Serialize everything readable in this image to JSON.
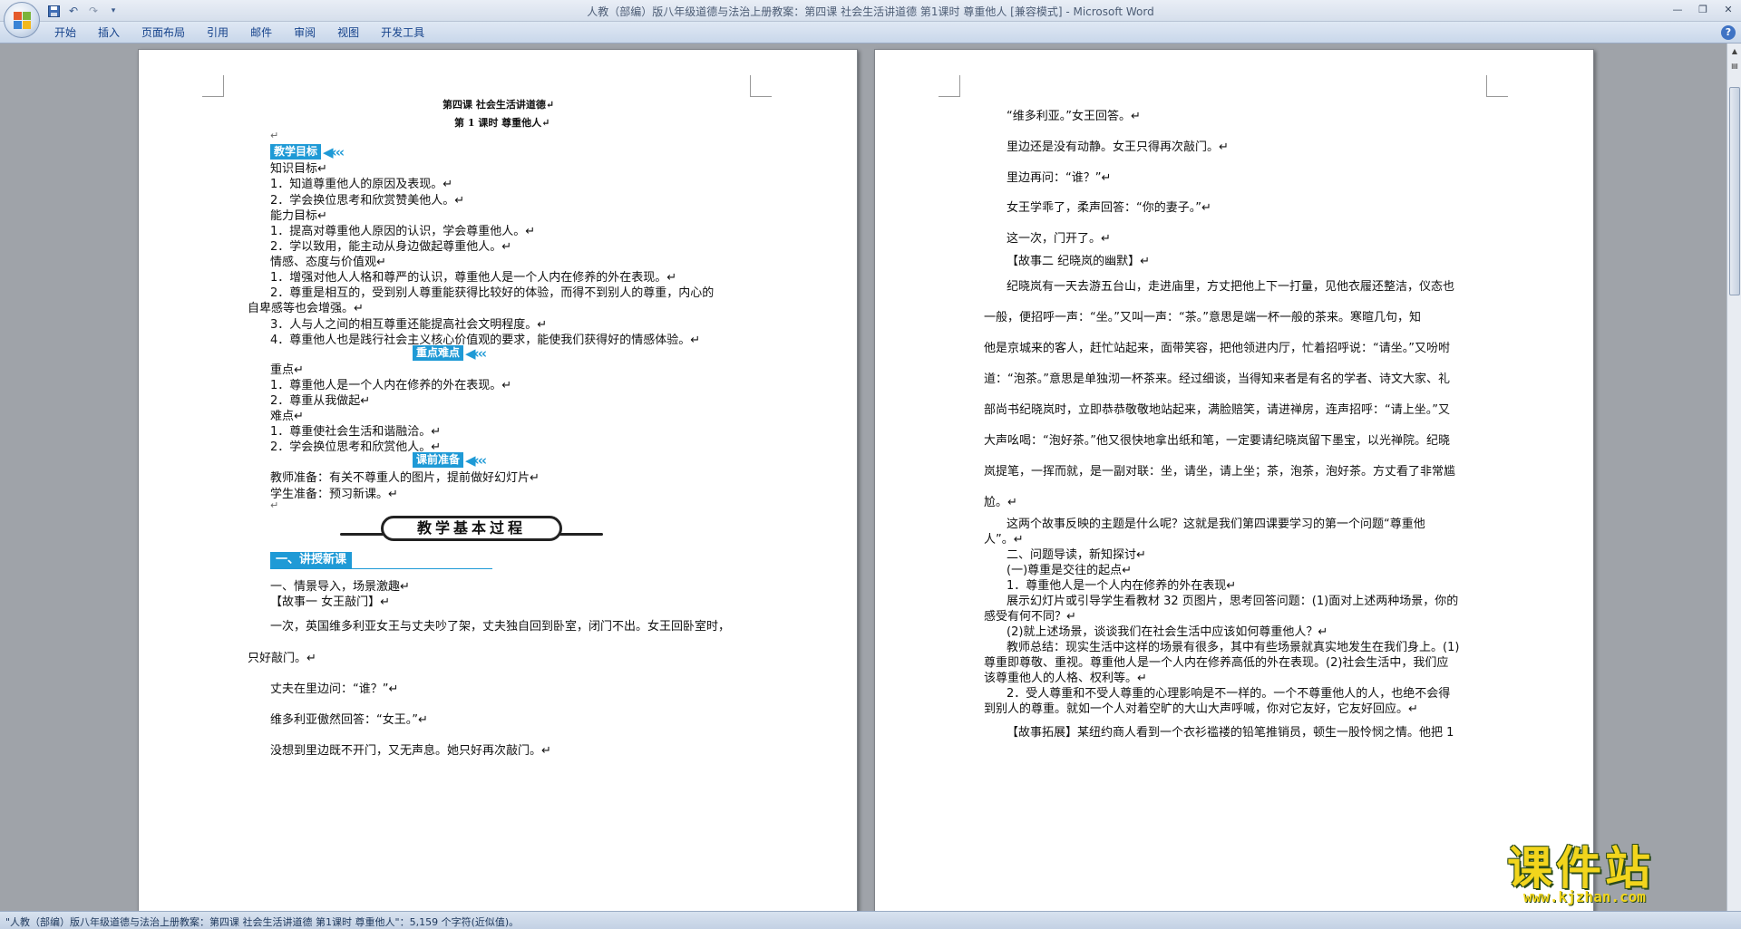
{
  "window": {
    "title": "人教（部编）版八年级道德与法治上册教案：第四课 社会生活讲道德 第1课时   尊重他人 [兼容模式] - Microsoft Word"
  },
  "quick_access": [
    {
      "icon": "save-icon"
    },
    {
      "icon": "undo-icon"
    },
    {
      "icon": "redo-icon"
    },
    {
      "icon": "customize-icon"
    }
  ],
  "ribbon": {
    "tabs": [
      "开始",
      "插入",
      "页面布局",
      "引用",
      "邮件",
      "审阅",
      "视图",
      "开发工具"
    ],
    "help": "?"
  },
  "left_page": {
    "title1": "第四课   社会生活讲道德↵",
    "title2": "第 1 课时    尊重他人↵",
    "hdr_objectives": "教学目标",
    "hdr_keypoints": "重点难点",
    "hdr_prep": "课前准备",
    "banner": "教学基本过程",
    "lecture_hdr": "一、讲授新课",
    "lines": [
      "↵",
      "知识目标↵",
      "1．知道尊重他人的原因及表现。↵",
      "2．学会换位思考和欣赏赞美他人。↵",
      "能力目标↵",
      "1．提高对尊重他人原因的认识，学会尊重他人。↵",
      "2．学以致用，能主动从身边做起尊重他人。↵",
      "情感、态度与价值观↵",
      "1．增强对他人人格和尊严的认识，尊重他人是一个人内在修养的外在表现。↵",
      "2．尊重是相互的，受到别人尊重能获得比较好的体验，而得不到别人的尊重，内心的",
      "自卑感等也会增强。↵",
      "3．人与人之间的相互尊重还能提高社会文明程度。↵",
      "4．尊重他人也是践行社会主义核心价值观的要求，能使我们获得好的情感体验。↵",
      "重点↵",
      "1．尊重他人是一个人内在修养的外在表现。↵",
      "2．尊重从我做起↵",
      "难点↵",
      "1．尊重使社会生活和谐融洽。↵",
      "2．学会换位思考和欣赏他人。↵",
      "教师准备：有关不尊重人的图片，提前做好幻灯片↵",
      "学生准备：预习新课。↵",
      "↵",
      "一、情景导入，场景激趣↵",
      "【故事一    女王敲门】↵",
      "一次，英国维多利亚女王与丈夫吵了架，丈夫独自回到卧室，闭门不出。女王回卧室时，",
      "只好敲门。↵",
      "丈夫在里边问：“谁？”↵",
      "维多利亚傲然回答：“女王。”↵",
      "没想到里边既不开门，又无声息。她只好再次敲门。↵"
    ]
  },
  "right_page": {
    "lines": [
      "“维多利亚。”女王回答。↵",
      "里边还是没有动静。女王只得再次敲门。↵",
      "里边再问：“谁？”↵",
      "女王学乖了，柔声回答：“你的妻子。”↵",
      "这一次，门开了。↵",
      "【故事二    纪晓岚的幽默】↵",
      "纪晓岚有一天去游五台山，走进庙里，方丈把他上下一打量，见他衣履还整洁，仪态也",
      "一般，便招呼一声：“坐。”又叫一声：“茶。”意思是端一杯一般的茶来。寒暄几句，知",
      "他是京城来的客人，赶忙站起来，面带笑容，把他领进内厅，忙着招呼说：“请坐。”又吩咐",
      "道：“泡茶。”意思是单独沏一杯茶来。经过细谈，当得知来者是有名的学者、诗文大家、礼",
      "部尚书纪晓岚时，立即恭恭敬敬地站起来，满脸赔笑，请进禅房，连声招呼：“请上坐。”又",
      "大声吆喝：“泡好茶。”他又很快地拿出纸和笔，一定要请纪晓岚留下墨宝，以光禅院。纪晓",
      "岚提笔，一挥而就，是一副对联：坐，请坐，请上坐；茶，泡茶，泡好茶。方丈看了非常尴",
      "尬。↵",
      "这两个故事反映的主题是什么呢？这就是我们第四课要学习的第一个问题“尊重他",
      "人”。↵",
      "二、问题导读，新知探讨↵",
      "(一)尊重是交往的起点↵",
      "1．尊重他人是一个人内在修养的外在表现↵",
      "展示幻灯片或引导学生看教材 32 页图片，思考回答问题：(1)面对上述两种场景，你的",
      "感受有何不同？↵",
      "(2)就上述场景，谈谈我们在社会生活中应该如何尊重他人？↵",
      "教师总结：现实生活中这样的场景有很多，其中有些场景就真实地发生在我们身上。(1)",
      "尊重即尊敬、重视。尊重他人是一个人内在修养高低的外在表现。(2)社会生活中，我们应",
      "该尊重他人的人格、权利等。↵",
      "2．受人尊重和不受人尊重的心理影响是不一样的。一个不尊重他人的人，也绝不会得",
      "到别人的尊重。就如一个人对着空旷的大山大声呼喊，你对它友好，它友好回应。↵",
      "【故事拓展】某纽约商人看到一个衣衫褴褛的铅笔推销员，顿生一股怜悯之情。他把 1"
    ]
  },
  "status_bar": {
    "text": "\"人教（部编）版八年级道德与法治上册教案：第四课 社会生活讲道德 第1课时    尊重他人\"：5,159 个字符(近似值)。"
  },
  "watermark": {
    "big": "课件站",
    "url": "www.kjzhan.com"
  },
  "colors": {
    "accent_blue": "#1f9ad6",
    "watermark_yellow": "#f2d51c"
  }
}
